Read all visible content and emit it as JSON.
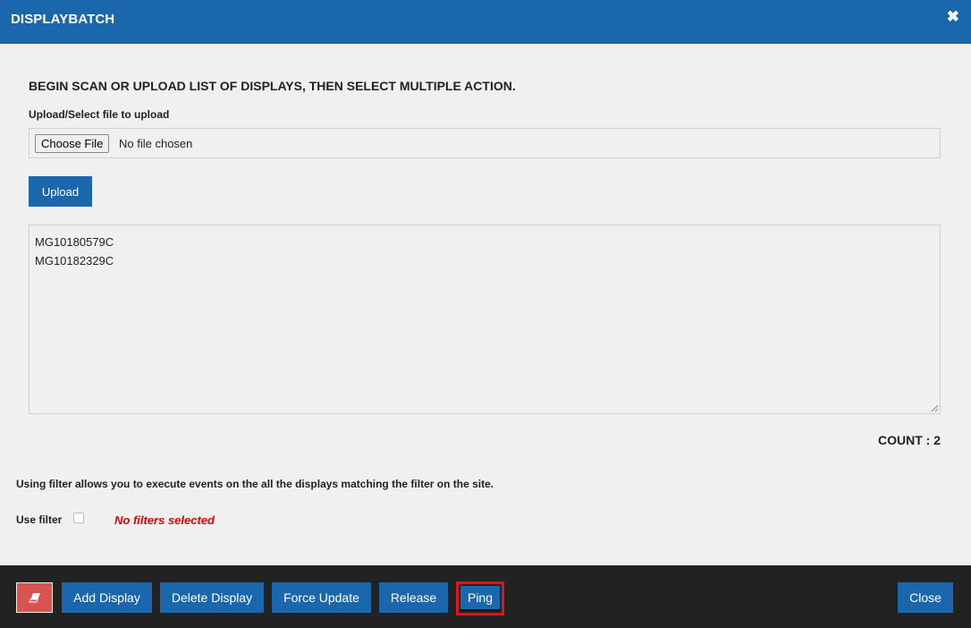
{
  "dialog": {
    "title": "DISPLAYBATCH",
    "close_glyph": "✖",
    "close_icon": "close-icon"
  },
  "main": {
    "instructions": "BEGIN SCAN OR UPLOAD LIST OF DISPLAYS, THEN SELECT MULTIPLE ACTION.",
    "upload_label": "Upload/Select file to upload",
    "choose_file_label": "Choose File",
    "file_status": "No file chosen",
    "upload_button": "Upload",
    "display_list": [
      "MG10180579C",
      "MG10182329C"
    ],
    "count_text": "COUNT : 2"
  },
  "filter": {
    "note": "Using filter allows you to execute events on the all the displays matching the filter on the site.",
    "use_filter_label": "Use filter",
    "use_filter_checked": false,
    "status": "No filters selected"
  },
  "footer": {
    "clear_icon": "eraser-icon",
    "add_display": "Add Display",
    "delete_display": "Delete Display",
    "force_update": "Force Update",
    "release": "Release",
    "ping": "Ping",
    "close": "Close"
  },
  "colors": {
    "brand_blue": "#1a67ad",
    "danger_red": "#d9534f",
    "footer_bg": "#222222",
    "highlight_red": "#e0141e",
    "warning_text": "#e00000"
  }
}
